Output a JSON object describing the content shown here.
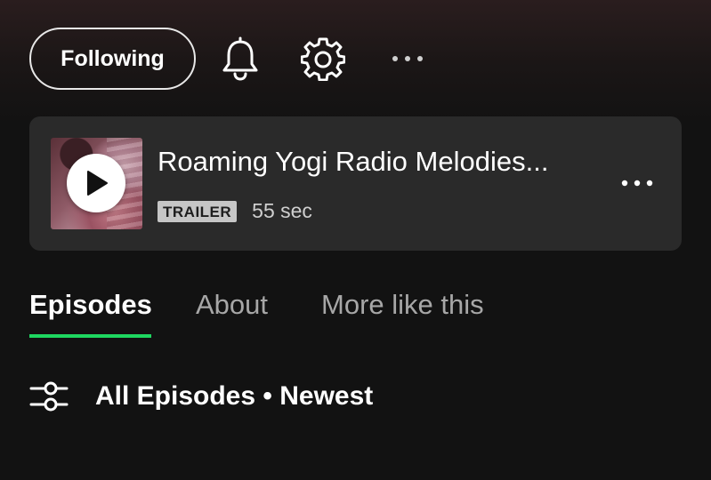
{
  "header": {
    "follow_label": "Following",
    "icons": {
      "notifications": "bell-icon",
      "settings": "gear-icon",
      "more": "more-horizontal-icon"
    }
  },
  "trailer": {
    "title": "Roaming Yogi Radio Melodies...",
    "badge": "TRAILER",
    "duration": "55 sec",
    "icons": {
      "play": "play-icon",
      "more": "more-horizontal-icon"
    }
  },
  "tabs": [
    {
      "label": "Episodes",
      "active": true
    },
    {
      "label": "About",
      "active": false
    },
    {
      "label": "More like this",
      "active": false
    }
  ],
  "filter": {
    "label": "All Episodes • Newest",
    "icon": "filter-sliders-icon"
  },
  "colors": {
    "background": "#121212",
    "card": "#2a2a2a",
    "accent": "#1ed760",
    "text_primary": "#ffffff",
    "text_secondary": "#a7a7a7",
    "badge": "#c6c6c6"
  }
}
